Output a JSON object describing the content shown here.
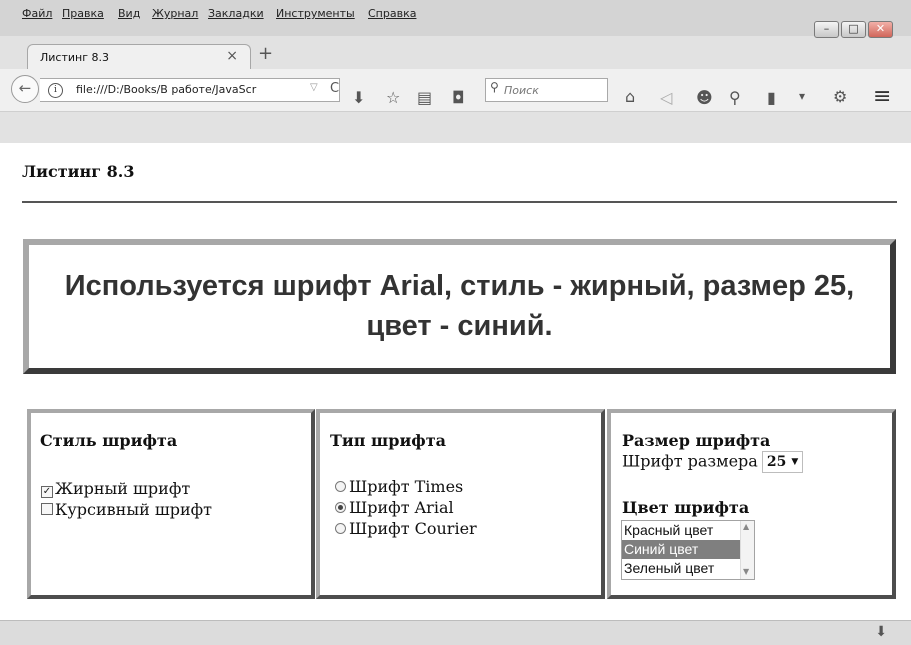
{
  "menu": [
    "Файл",
    "Правка",
    "Вид",
    "Журнал",
    "Закладки",
    "Инструменты",
    "Справка"
  ],
  "window_controls": {
    "minimize": "–",
    "maximize": "□",
    "close": "✕"
  },
  "tab": {
    "title": "Листинг 8.3",
    "close": "×",
    "new_tab": "+"
  },
  "nav": {
    "back": "←",
    "info": "i",
    "url": "file:///D:/Books/В работе/JavaScr",
    "url_dropdown": "▽",
    "reload": "C",
    "search_placeholder": "Поиск",
    "search_icon": "search-icon"
  },
  "toolbar_icons": [
    {
      "name": "downloads-icon",
      "glyph": "⬇"
    },
    {
      "name": "bookmark-star-icon",
      "glyph": "☆"
    },
    {
      "name": "bookmarks-library-icon",
      "glyph": "▤"
    },
    {
      "name": "pocket-icon",
      "glyph": "◘"
    },
    {
      "name": "home-icon",
      "glyph": "⌂"
    },
    {
      "name": "send-icon",
      "glyph": "◁"
    },
    {
      "name": "chat-icon",
      "glyph": "☻"
    },
    {
      "name": "addon-icon",
      "glyph": "⚲"
    },
    {
      "name": "clipboard-icon",
      "glyph": "▮"
    },
    {
      "name": "dropdown-icon",
      "glyph": "▾"
    },
    {
      "name": "palette-icon",
      "glyph": "⚙"
    },
    {
      "name": "hamburger-menu-icon",
      "glyph": "≡"
    }
  ],
  "page": {
    "heading": "Листинг 8.3",
    "demo_text": "Используется шрифт Arial, стиль - жирный, размер 25, цвет - синий."
  },
  "style_panel": {
    "title": "Стиль шрифта",
    "options": [
      {
        "label": "Жирный шрифт",
        "checked": true
      },
      {
        "label": "Курсивный шрифт",
        "checked": false
      }
    ]
  },
  "type_panel": {
    "title": "Тип шрифта",
    "options": [
      {
        "label": "Шрифт Times",
        "selected": false
      },
      {
        "label": "Шрифт Arial",
        "selected": true
      },
      {
        "label": "Шрифт Courier",
        "selected": false
      }
    ]
  },
  "size_panel": {
    "title": "Размер шрифта",
    "size_label": "Шрифт размера",
    "size_value": "25",
    "color_title": "Цвет шрифта",
    "colors": [
      {
        "label": "Красный цвет",
        "selected": false
      },
      {
        "label": "Синий цвет",
        "selected": true
      },
      {
        "label": "Зеленый цвет",
        "selected": false
      }
    ]
  },
  "status": {
    "download_icon": "⬇"
  }
}
